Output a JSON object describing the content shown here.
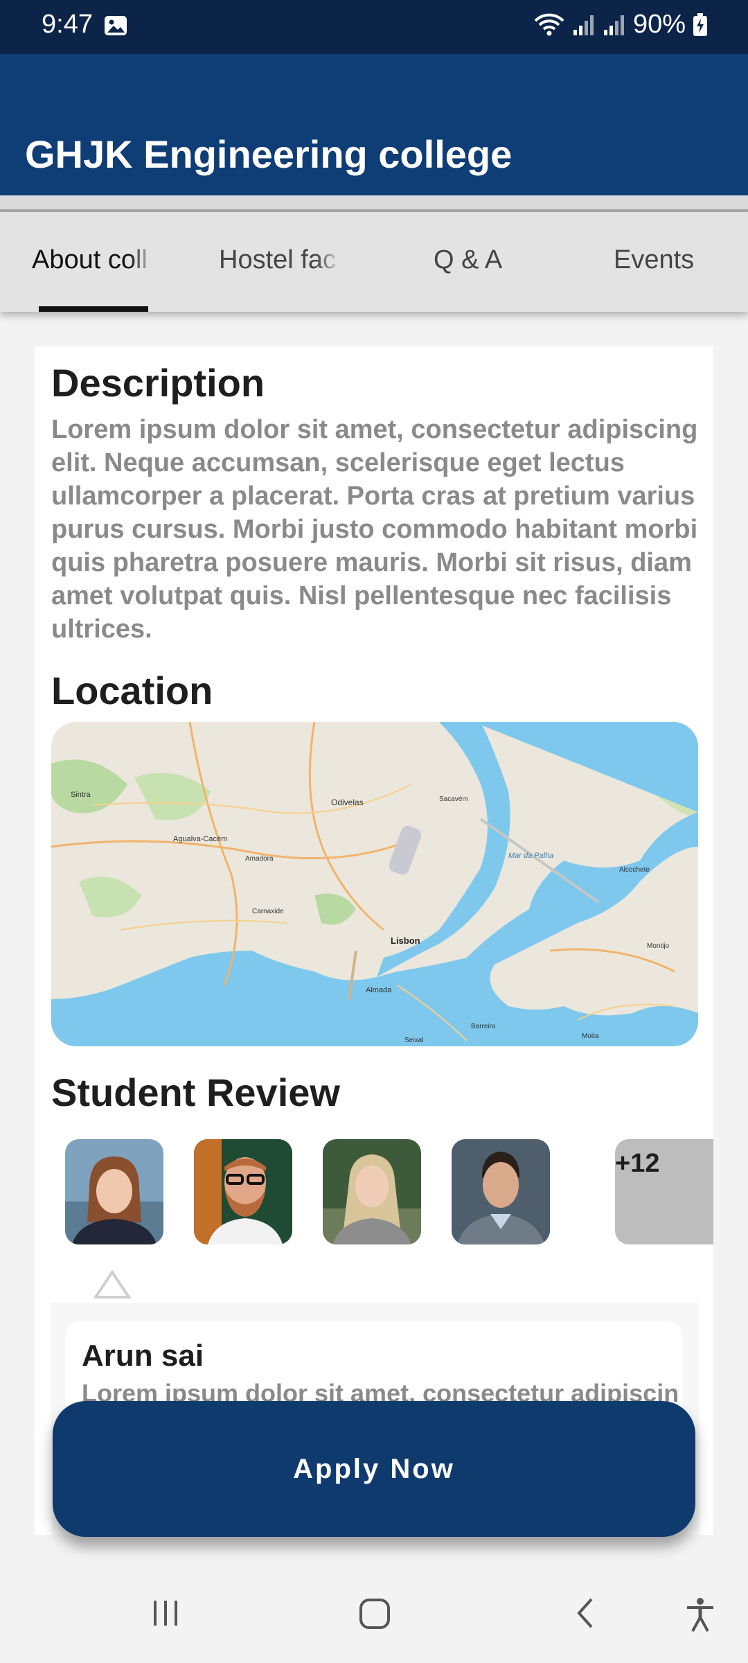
{
  "status_bar": {
    "time": "9:47",
    "battery": "90%"
  },
  "app_bar": {
    "title": "GHJK Engineering college"
  },
  "tabs": [
    {
      "label": "About coll",
      "active": true
    },
    {
      "label": "Hostel fac",
      "active": false
    },
    {
      "label": "Q & A",
      "active": false
    },
    {
      "label": "Events",
      "active": false
    }
  ],
  "description": {
    "heading": "Description",
    "text": "Lorem ipsum dolor sit amet, consectetur adipiscing elit. Neque accumsan, scelerisque eget lectus ullamcorper a placerat. Porta cras at pretium varius purus cursus. Morbi justo commodo habitant morbi quis pharetra posuere mauris. Morbi sit risus, diam amet volutpat quis. Nisl pellentesque nec facilisis ultrices."
  },
  "location": {
    "heading": "Location",
    "map_labels": [
      "Odivelas",
      "Lisbon",
      "Almada",
      "Agualva-Cacém",
      "Sintra",
      "Amadora",
      "Carnaxide",
      "Sacavém",
      "Mar da Palha",
      "Alcochete",
      "Montijo",
      "Barreiro",
      "Moita",
      "Seixal"
    ]
  },
  "student_review": {
    "heading": "Student Review",
    "avatars": [
      "avatar-1",
      "avatar-2",
      "avatar-3",
      "avatar-4"
    ],
    "more_count": "+12",
    "review": {
      "name": "Arun sai",
      "text": "Lorem ipsum dolor sit amet, consectetur adipiscing"
    }
  },
  "apply_button": {
    "label": "Apply Now"
  },
  "nav_bar": {
    "icons": [
      "recents-icon",
      "home-icon",
      "back-icon",
      "accessibility-icon"
    ]
  },
  "colors": {
    "status_bar": "#0b2447",
    "app_bar": "#0f3d75",
    "button": "#0f3a6e",
    "muted_text": "#8a8a8a"
  }
}
